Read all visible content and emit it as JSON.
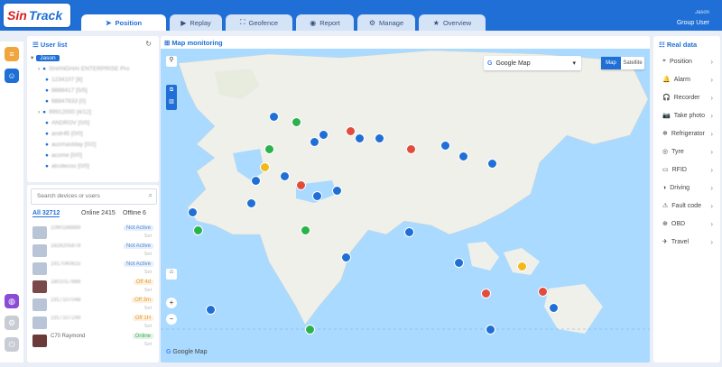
{
  "header": {
    "logo_a": "Sin",
    "logo_b": "Track",
    "tabs": [
      {
        "label": "Position",
        "icon": "➤",
        "active": true
      },
      {
        "label": "Replay",
        "icon": "▶",
        "active": false
      },
      {
        "label": "Geofence",
        "icon": "⛶",
        "active": false
      },
      {
        "label": "Report",
        "icon": "◉",
        "active": false
      },
      {
        "label": "Manage",
        "icon": "⚙",
        "active": false
      },
      {
        "label": "Overview",
        "icon": "★",
        "active": false
      }
    ],
    "user_name": "Jason",
    "user_role": "Group User"
  },
  "user_list": {
    "title": "User list",
    "root": "Jason",
    "children": [
      "SHANGHAI ENTERPRISE Pro",
      "1234107 [8]",
      "8888417 [5/5]",
      "68847833 [0]",
      "99912000 [4/12]",
      "ANDROV [0/0]",
      "andr45 [0/0]",
      "aucmastday [0/2]",
      "acome [0/0]",
      "alcolecoo [0/0]"
    ],
    "search_placeholder": "Search devices or users",
    "filters": [
      "All 32712",
      "Online 2415",
      "Offline 6"
    ]
  },
  "devices": [
    {
      "name": "1090188889",
      "status": "Not Active",
      "color": "#5b8fd6",
      "sub": "Set"
    },
    {
      "name": "1828205878",
      "status": "Not Active",
      "color": "#5b8fd6",
      "sub": "Set"
    },
    {
      "name": "1917040815",
      "status": "Not Active",
      "color": "#5b8fd6",
      "sub": "Set"
    },
    {
      "name": "1801017886",
      "status": "Off 4d",
      "color": "#e39b3c",
      "sub": "Set"
    },
    {
      "name": "1917107048",
      "status": "Off 3m",
      "color": "#e39b3c",
      "sub": "Set"
    },
    {
      "name": "1917107249",
      "status": "Off 1H",
      "color": "#e39b3c",
      "sub": "Set"
    },
    {
      "name": "C70 Raymond",
      "status": "Online",
      "color": "#42b05a",
      "sub": "Set"
    }
  ],
  "map": {
    "title": "Map monitoring",
    "provider": "Google Map",
    "type_map": "Map",
    "type_sat": "Satellite",
    "attribution": "Google Map"
  },
  "realdata": {
    "title": "Real data",
    "items": [
      {
        "label": "Position",
        "icon": "⌖"
      },
      {
        "label": "Alarm",
        "icon": "🔔"
      },
      {
        "label": "Recorder",
        "icon": "🎧"
      },
      {
        "label": "Take photo",
        "icon": "📷"
      },
      {
        "label": "Refrigerator",
        "icon": "❄"
      },
      {
        "label": "Tyre",
        "icon": "◎"
      },
      {
        "label": "RFID",
        "icon": "▭"
      },
      {
        "label": "Driving",
        "icon": "◑"
      },
      {
        "label": "Fault code",
        "icon": "⚠"
      },
      {
        "label": "OBD",
        "icon": "⊕"
      },
      {
        "label": "Travel",
        "icon": "✈"
      }
    ]
  },
  "colors": {
    "accent": "#1f6fd6",
    "marker_blue": "#1f6fd6",
    "marker_green": "#2bb24c",
    "marker_red": "#e14c3c",
    "marker_yellow": "#f3b819"
  }
}
